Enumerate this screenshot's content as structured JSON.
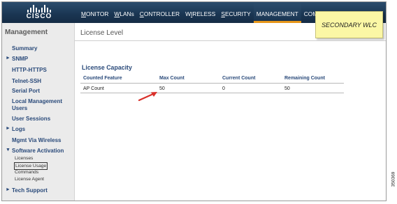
{
  "brand": {
    "logo_text": "CISCO"
  },
  "nav": {
    "items": [
      {
        "label": "MONITOR",
        "u": "M",
        "rest": "ONITOR"
      },
      {
        "label": "WLANs",
        "u": "W",
        "rest": "LANs"
      },
      {
        "label": "CONTROLLER",
        "u": "C",
        "rest": "ONTROLLER"
      },
      {
        "label": "WIRELESS",
        "u": "I",
        "pre": "W",
        "rest": "RELESS"
      },
      {
        "label": "SECURITY",
        "u": "S",
        "rest": "ECURITY"
      },
      {
        "label": "MANAGEMENT",
        "u": "",
        "rest": "MANAGEMENT"
      },
      {
        "label": "COMMANDS",
        "u": "",
        "rest": "COMMA"
      }
    ],
    "active": "MANAGEMENT"
  },
  "callout": {
    "text": "SECONDARY WLC"
  },
  "sidebar": {
    "title": "Management",
    "items": [
      {
        "label": "Summary"
      },
      {
        "label": "SNMP"
      },
      {
        "label": "HTTP-HTTPS"
      },
      {
        "label": "Telnet-SSH"
      },
      {
        "label": "Serial Port"
      },
      {
        "label": "Local Management Users"
      },
      {
        "label": "User Sessions"
      },
      {
        "label": "Logs"
      },
      {
        "label": "Mgmt Via Wireless"
      },
      {
        "label": "Software Activation"
      },
      {
        "label": "Tech Support"
      }
    ],
    "sub_items": [
      {
        "label": "Licenses"
      },
      {
        "label": "License Usage"
      },
      {
        "label": "Commands"
      },
      {
        "label": "License Agent"
      }
    ]
  },
  "main": {
    "page_title": "License Level",
    "section_title": "License Capacity",
    "table": {
      "columns": [
        "Counted Feature",
        "Max Count",
        "Current Count",
        "Remaining Count"
      ],
      "rows": [
        [
          "AP Count",
          "50",
          "0",
          "50"
        ]
      ]
    }
  },
  "figure_id": "350369",
  "colors": {
    "header": "#1a3552",
    "active_tab_underline": "#e6961a",
    "link_blue": "#2a4a7a",
    "callout_bg": "#fbf7a5",
    "arrow": "#d9302a"
  }
}
